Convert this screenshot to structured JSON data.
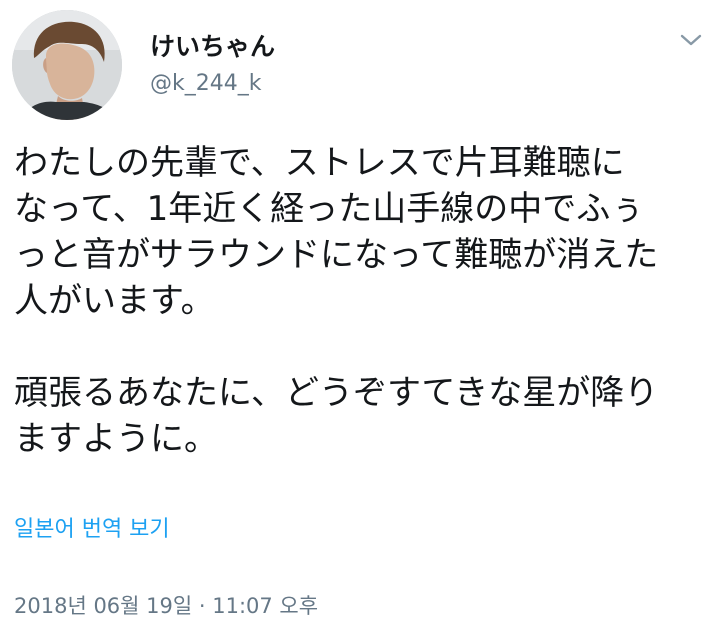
{
  "author": {
    "display_name": "けいちゃん",
    "handle": "@k_244_k",
    "avatar_icon": "profile-photo"
  },
  "tweet": {
    "lines": [
      "わたしの先輩で、ストレスで片耳難聴に",
      "なって、1年近く経った山手線の中でふぅ",
      "っと音がサラウンドになって難聴が消えた",
      "人がいます。",
      "",
      "頑張るあなたに、どうぞすてきな星が降り",
      "ますように。"
    ],
    "translate_label": "일본어 번역 보기",
    "timestamp": "2018년 06월 19일 · 11:07 오후"
  },
  "menu": {
    "caret_icon": "chevron-down-icon"
  },
  "colors": {
    "link": "#1da1f2",
    "secondary_text": "#657786",
    "primary_text": "#14171a"
  }
}
